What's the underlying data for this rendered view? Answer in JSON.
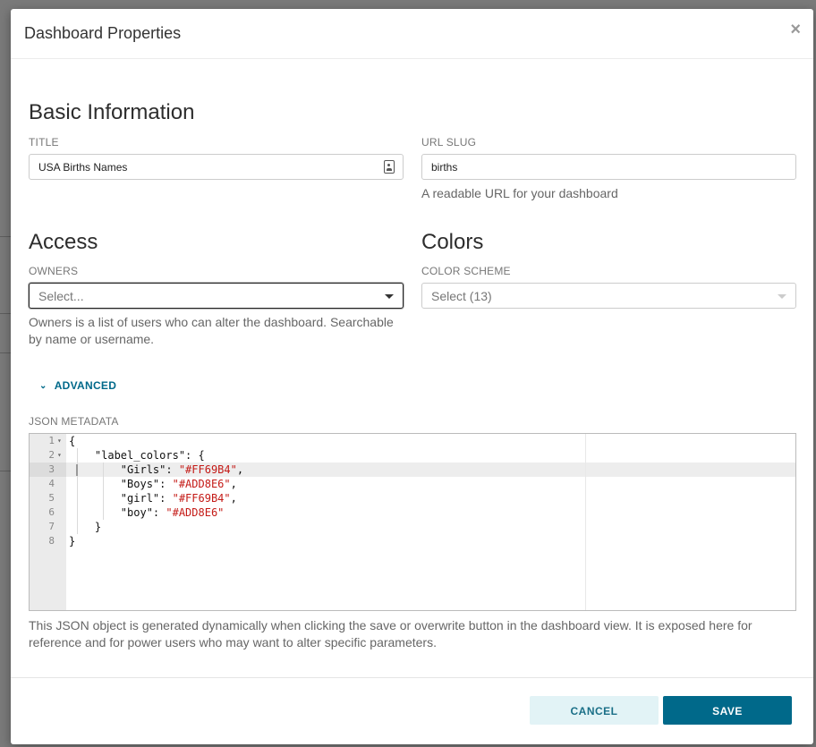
{
  "modal": {
    "title": "Dashboard Properties",
    "close": "×"
  },
  "basic": {
    "heading": "Basic Information",
    "title_label": "TITLE",
    "title_value": "USA Births Names",
    "slug_label": "URL SLUG",
    "slug_value": "births",
    "slug_help": "A readable URL for your dashboard"
  },
  "access": {
    "heading": "Access",
    "owners_label": "OWNERS",
    "owners_placeholder": "Select...",
    "owners_help_1": "Owners is a list of users who can alter the dashboard. Searchable",
    "owners_help_2": "by name or username."
  },
  "colors": {
    "heading": "Colors",
    "scheme_label": "COLOR SCHEME",
    "scheme_placeholder": "Select (13)"
  },
  "advanced": {
    "toggle_label": "ADVANCED",
    "chevron": "⌄",
    "json_label": "JSON METADATA",
    "json_help_1": "This JSON object is generated dynamically when clicking the save or overwrite button in the dashboard view. It is exposed here for",
    "json_help_2": "reference and for power users who may want to alter specific parameters."
  },
  "editor": {
    "lines": [
      {
        "n": "1",
        "fold": "▾",
        "text": "{"
      },
      {
        "n": "2",
        "fold": "▾",
        "text": "    \"label_colors\": {"
      },
      {
        "n": "3",
        "fold": "",
        "key": "        \"Girls\": ",
        "val": "\"#FF69B4\"",
        "tail": ","
      },
      {
        "n": "4",
        "fold": "",
        "key": "        \"Boys\": ",
        "val": "\"#ADD8E6\"",
        "tail": ","
      },
      {
        "n": "5",
        "fold": "",
        "key": "        \"girl\": ",
        "val": "\"#FF69B4\"",
        "tail": ","
      },
      {
        "n": "6",
        "fold": "",
        "key": "        \"boy\": ",
        "val": "\"#ADD8E6\"",
        "tail": ""
      },
      {
        "n": "7",
        "fold": "",
        "text": "    }"
      },
      {
        "n": "8",
        "fold": "",
        "text": "}"
      }
    ]
  },
  "footer": {
    "cancel_label": "CANCEL",
    "save_label": "SAVE"
  },
  "colors_theme": {
    "accent": "#00698a",
    "cancel_bg": "#e2f3f6",
    "json_string": "#c41a16"
  }
}
